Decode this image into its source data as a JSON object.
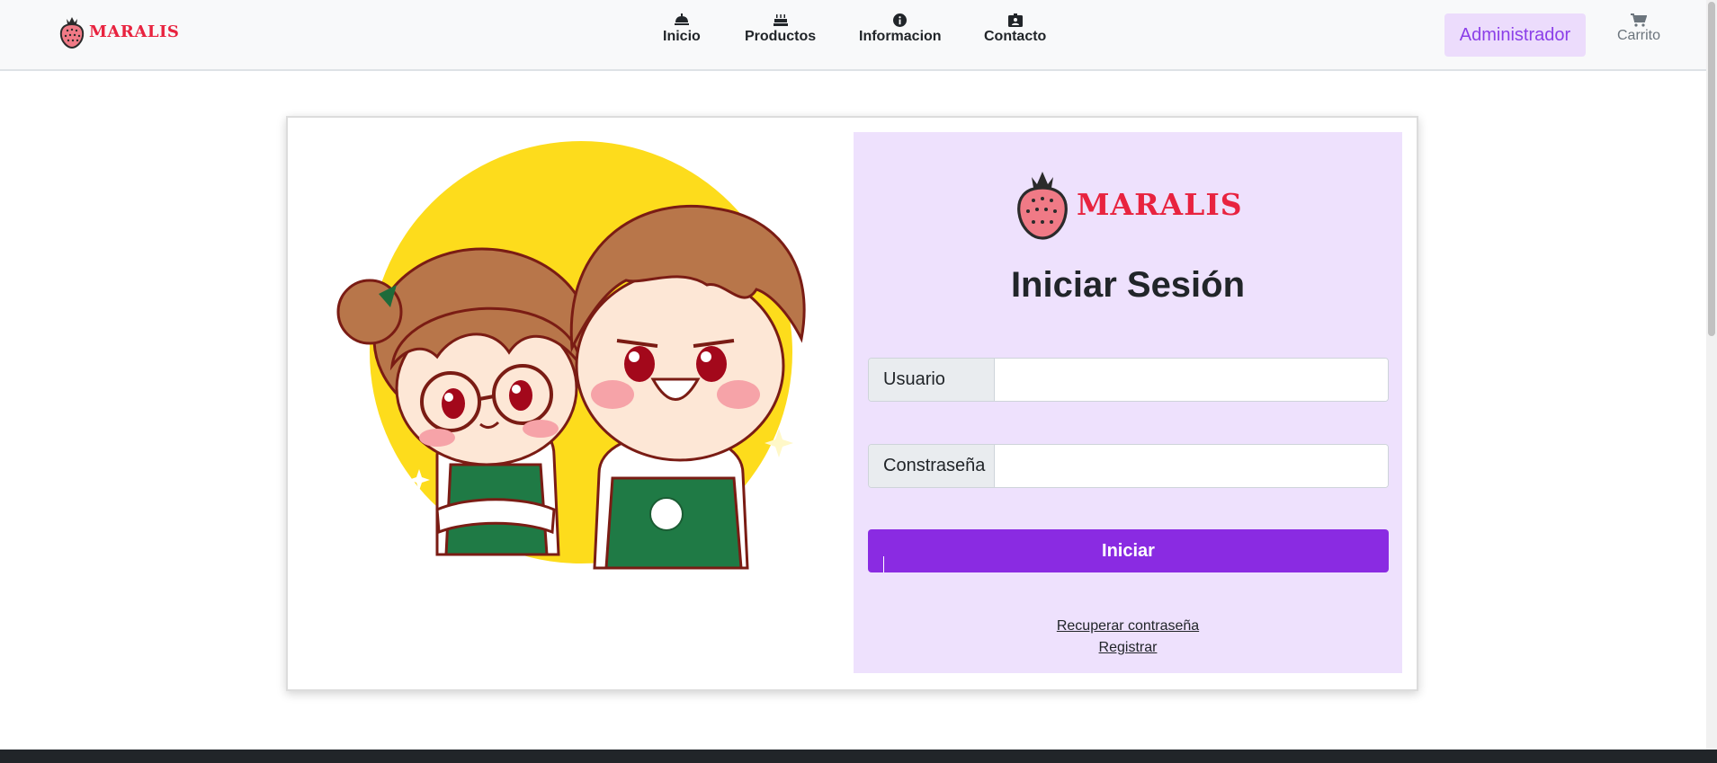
{
  "brand": {
    "name": "MARALIS",
    "icon": "strawberry-icon",
    "color": "#e8233f"
  },
  "nav": {
    "items": [
      {
        "label": "Inicio",
        "icon": "home-bell-icon"
      },
      {
        "label": "Productos",
        "icon": "cake-icon"
      },
      {
        "label": "Informacion",
        "icon": "info-circle-icon"
      },
      {
        "label": "Contacto",
        "icon": "contact-card-icon"
      }
    ],
    "admin_label": "Administrador",
    "cart_label": "Carrito",
    "cart_icon": "cart-icon"
  },
  "login": {
    "title": "Iniciar Sesión",
    "logo_text": "MARALIS",
    "user_label": "Usuario",
    "user_value": "",
    "password_label": "Constraseña",
    "password_value": "",
    "submit_label": "Iniciar",
    "recover_link": "Recuperar contraseña",
    "register_link": "Registrar"
  },
  "illustration": {
    "description_icon": "baristas-illustration"
  },
  "colors": {
    "accent": "#8a2be2",
    "panel_bg": "#eee1fd",
    "admin_bg": "#ecdcfc",
    "admin_text": "#8b3fe8",
    "footer": "#212529"
  }
}
